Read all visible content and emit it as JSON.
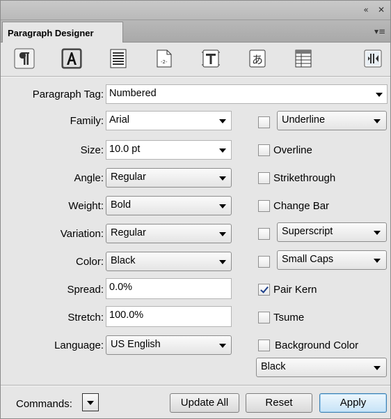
{
  "panel": {
    "tab_title": "Paragraph Designer",
    "collapse_glyph": "«",
    "close_glyph": "✕",
    "menu_glyph": "▾≡"
  },
  "toolbar": {
    "buttons": [
      {
        "name": "basic-properties-icon"
      },
      {
        "name": "default-font-icon"
      },
      {
        "name": "pagination-icon"
      },
      {
        "name": "numbering-icon"
      },
      {
        "name": "advanced-icon"
      },
      {
        "name": "asian-icon"
      },
      {
        "name": "table-cell-icon"
      },
      {
        "name": "direction-icon"
      }
    ]
  },
  "form": {
    "paragraph_tag": {
      "label": "Paragraph Tag:",
      "value": "Numbered"
    },
    "family": {
      "label": "Family:",
      "value": "Arial"
    },
    "size": {
      "label": "Size:",
      "value": "10.0 pt"
    },
    "angle": {
      "label": "Angle:",
      "value": "Regular"
    },
    "weight": {
      "label": "Weight:",
      "value": "Bold"
    },
    "variation": {
      "label": "Variation:",
      "value": "Regular"
    },
    "color": {
      "label": "Color:",
      "value": "Black"
    },
    "spread": {
      "label": "Spread:",
      "value": "0.0%"
    },
    "stretch": {
      "label": "Stretch:",
      "value": "100.0%"
    },
    "language": {
      "label": "Language:",
      "value": "US English"
    }
  },
  "options": {
    "underline": {
      "value": "Underline",
      "checked": false
    },
    "overline": {
      "label": "Overline",
      "checked": false
    },
    "strikethrough": {
      "label": "Strikethrough",
      "checked": false
    },
    "change_bar": {
      "label": "Change Bar",
      "checked": false
    },
    "superscript": {
      "value": "Superscript",
      "checked": false
    },
    "small_caps": {
      "value": "Small Caps",
      "checked": false
    },
    "pair_kern": {
      "label": "Pair Kern",
      "checked": true
    },
    "tsume": {
      "label": "Tsume",
      "checked": false
    },
    "background_color": {
      "label": "Background Color",
      "checked": false,
      "value": "Black"
    }
  },
  "footer": {
    "commands_label": "Commands:",
    "update_all": "Update All",
    "reset": "Reset",
    "apply": "Apply"
  }
}
